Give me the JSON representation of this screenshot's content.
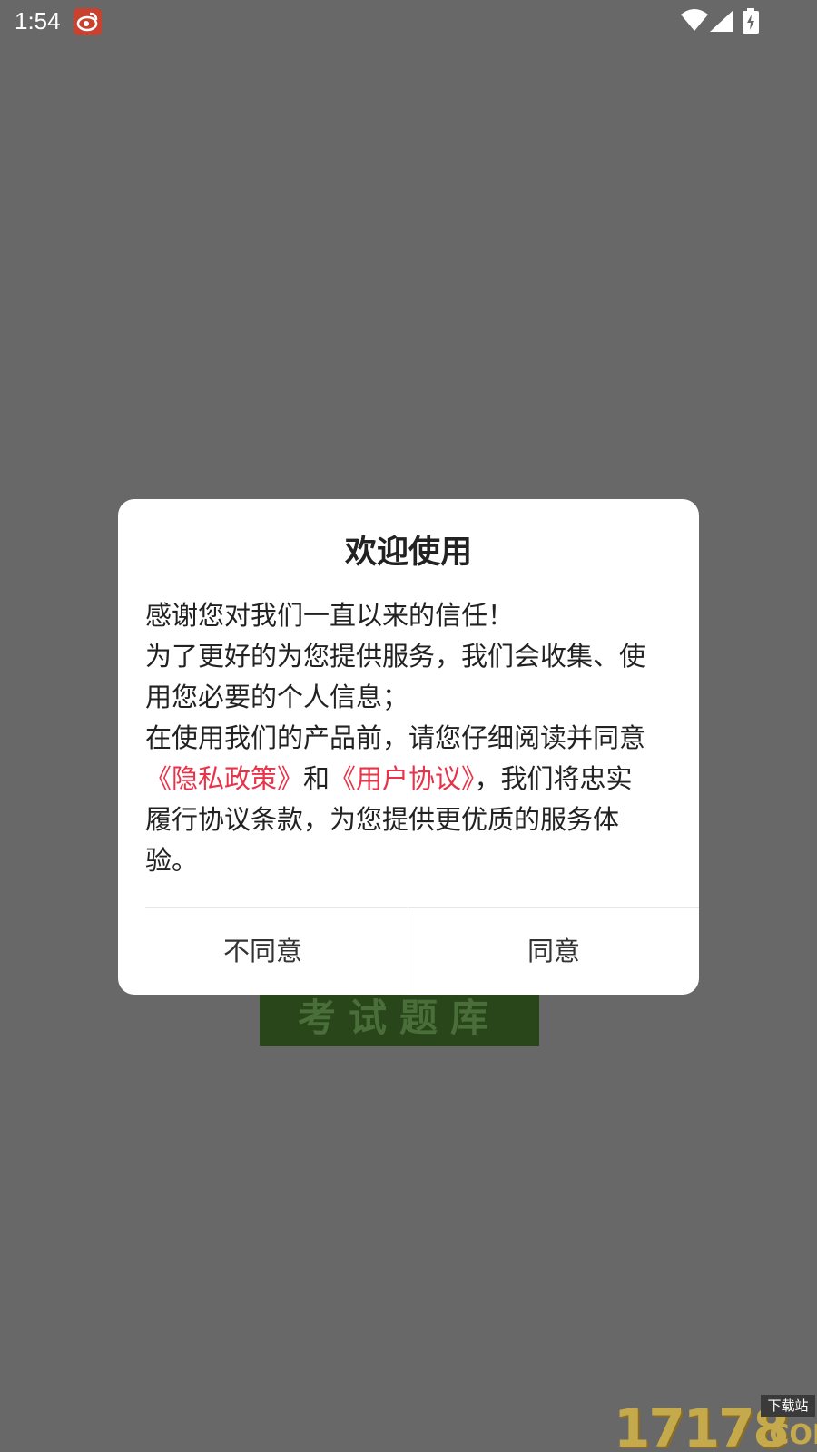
{
  "status_bar": {
    "time": "1:54",
    "notification_icon": "weibo-icon",
    "icons": [
      "wifi-icon",
      "signal-icon",
      "battery-charging-icon"
    ]
  },
  "background": {
    "banner_text": "考试题库"
  },
  "dialog": {
    "title": "欢迎使用",
    "body": {
      "line1": "感谢您对我们一直以来的信任！",
      "line2": "为了更好的为您提供服务，我们会收集、使",
      "line3": "用您必要的个人信息；",
      "line4": "在使用我们的产品前，请您仔细阅读并同意",
      "privacy_link": "《隐私政策》",
      "and": "和",
      "agreement_link": "《用户协议》",
      "line5_rest": "，我们将忠实",
      "line6": "履行协议条款，为您提供更优质的服务体",
      "line7": "验。"
    },
    "buttons": {
      "disagree": "不同意",
      "agree": "同意"
    }
  },
  "watermark": {
    "number": "17178",
    "sub": "下载站",
    "com": ".COM"
  },
  "colors": {
    "overlay": "#686868",
    "link": "#e8334a",
    "banner": "#284619"
  }
}
